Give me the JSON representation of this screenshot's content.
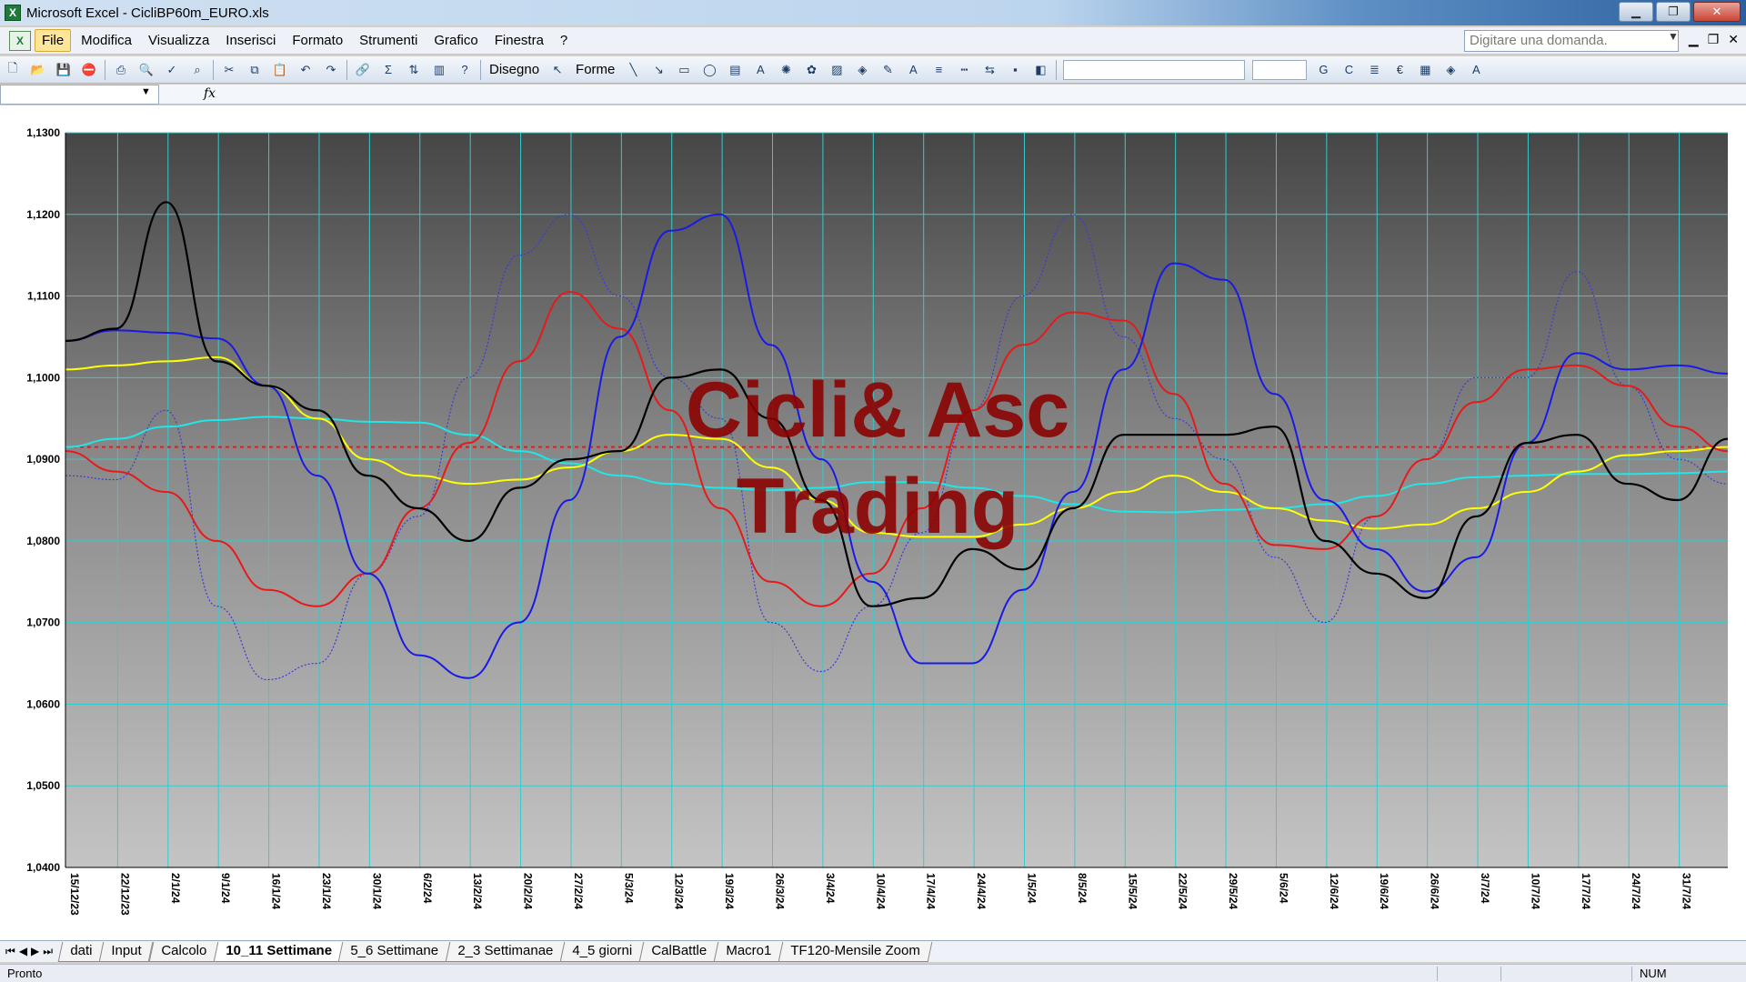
{
  "window": {
    "title": "Microsoft Excel - CicliBP60m_EURO.xls"
  },
  "menu": {
    "items": [
      "File",
      "Modifica",
      "Visualizza",
      "Inserisci",
      "Formato",
      "Strumenti",
      "Grafico",
      "Finestra",
      "?"
    ],
    "ask_placeholder": "Digitare una domanda."
  },
  "toolbar": {
    "draw_label": "Disegno",
    "shapes_label": "Forme",
    "bold": "G",
    "italic": "C",
    "euro": "€"
  },
  "formula": {
    "fx": "fx"
  },
  "sheets": [
    "dati",
    "Input",
    "Calcolo",
    "10_11 Settimane",
    "5_6 Settimane",
    "2_3 Settimanae",
    "4_5  giorni",
    "CalBattle",
    "Macro1",
    "TF120-Mensile Zoom"
  ],
  "active_sheet": "10_11 Settimane",
  "status": {
    "left": "Pronto",
    "num": "NUM"
  },
  "watermark": [
    "Cicli& Asc",
    "Trading"
  ],
  "colors": {
    "price": "#000000",
    "blue_cycle": "#1a1ae6",
    "red_cycle": "#e61a1a",
    "yellow_ma": "#ffff00",
    "cyan_ma": "#22e6e6",
    "dotted_blue": "#3b3bd6",
    "ref_line": "#e61a1a",
    "watermark": "#8b0000",
    "grid": "#33cccc"
  },
  "chart_data": {
    "type": "line",
    "y_ticks": [
      "1,1300",
      "1,1200",
      "1,1100",
      "1,1000",
      "1,0900",
      "1,0800",
      "1,0700",
      "1,0600",
      "1,0500",
      "1,0400"
    ],
    "ylim": [
      1.04,
      1.13
    ],
    "x_labels": [
      "15/12/23",
      "22/12/23",
      "2/1/24",
      "9/1/24",
      "16/1/24",
      "23/1/24",
      "30/1/24",
      "6/2/24",
      "13/2/24",
      "20/2/24",
      "27/2/24",
      "5/3/24",
      "12/3/24",
      "19/3/24",
      "26/3/24",
      "3/4/24",
      "10/4/24",
      "17/4/24",
      "24/4/24",
      "1/5/24",
      "8/5/24",
      "15/5/24",
      "22/5/24",
      "29/5/24",
      "5/6/24",
      "12/6/24",
      "19/6/24",
      "26/6/24",
      "3/7/24",
      "10/7/24",
      "17/7/24",
      "24/7/24",
      "31/7/24"
    ],
    "reference_line": 1.0915,
    "series": [
      {
        "color": "black",
        "values": [
          1.1045,
          1.106,
          1.1215,
          1.102,
          1.099,
          1.096,
          1.088,
          1.084,
          1.08,
          1.0865,
          1.09,
          1.091,
          1.1,
          1.101,
          1.095,
          1.085,
          1.072,
          1.073,
          1.079,
          1.0765,
          1.084,
          1.093,
          1.093,
          1.093,
          1.094,
          1.08,
          1.076,
          1.073,
          1.083,
          1.092,
          1.093,
          1.087,
          1.085,
          1.0925
        ]
      },
      {
        "color": "blue",
        "values": [
          1.1045,
          1.1058,
          1.1055,
          1.1048,
          1.099,
          1.088,
          1.076,
          1.066,
          1.0632,
          1.07,
          1.085,
          1.105,
          1.118,
          1.12,
          1.104,
          1.09,
          1.075,
          1.065,
          1.065,
          1.074,
          1.086,
          1.101,
          1.114,
          1.112,
          1.098,
          1.085,
          1.079,
          1.0738,
          1.078,
          1.092,
          1.103,
          1.101,
          1.1015,
          1.1005
        ]
      },
      {
        "color": "red",
        "values": [
          1.091,
          1.0885,
          1.086,
          1.08,
          1.074,
          1.072,
          1.076,
          1.084,
          1.092,
          1.102,
          1.1105,
          1.106,
          1.096,
          1.084,
          1.075,
          1.072,
          1.076,
          1.084,
          1.096,
          1.104,
          1.108,
          1.107,
          1.098,
          1.087,
          1.0795,
          1.079,
          1.083,
          1.09,
          1.097,
          1.101,
          1.1015,
          1.099,
          1.094,
          1.091
        ]
      },
      {
        "color": "yellow",
        "values": [
          1.101,
          1.1015,
          1.102,
          1.1025,
          1.099,
          1.095,
          1.09,
          1.088,
          1.087,
          1.0875,
          1.089,
          1.091,
          1.093,
          1.0925,
          1.089,
          1.085,
          1.081,
          1.0805,
          1.0805,
          1.082,
          1.084,
          1.086,
          1.088,
          1.086,
          1.084,
          1.0825,
          1.0815,
          1.082,
          1.084,
          1.086,
          1.0885,
          1.0905,
          1.091,
          1.0915
        ]
      },
      {
        "color": "cyan",
        "values": [
          1.0915,
          1.0925,
          1.094,
          1.0948,
          1.0952,
          1.095,
          1.0946,
          1.0945,
          1.093,
          1.091,
          1.0895,
          1.088,
          1.087,
          1.0865,
          1.0862,
          1.0865,
          1.0872,
          1.0872,
          1.0865,
          1.0855,
          1.0845,
          1.0836,
          1.0835,
          1.0838,
          1.084,
          1.0845,
          1.0855,
          1.087,
          1.0878,
          1.088,
          1.0882,
          1.0882,
          1.0883,
          1.0885
        ]
      },
      {
        "color": "dotted-blue",
        "values": [
          1.088,
          1.0875,
          1.096,
          1.072,
          1.063,
          1.065,
          1.076,
          1.083,
          1.1,
          1.115,
          1.12,
          1.11,
          1.1,
          1.095,
          1.07,
          1.064,
          1.072,
          1.081,
          1.096,
          1.11,
          1.12,
          1.105,
          1.095,
          1.09,
          1.078,
          1.07,
          1.083,
          1.09,
          1.1,
          1.1,
          1.113,
          1.099,
          1.09,
          1.087
        ]
      }
    ]
  }
}
